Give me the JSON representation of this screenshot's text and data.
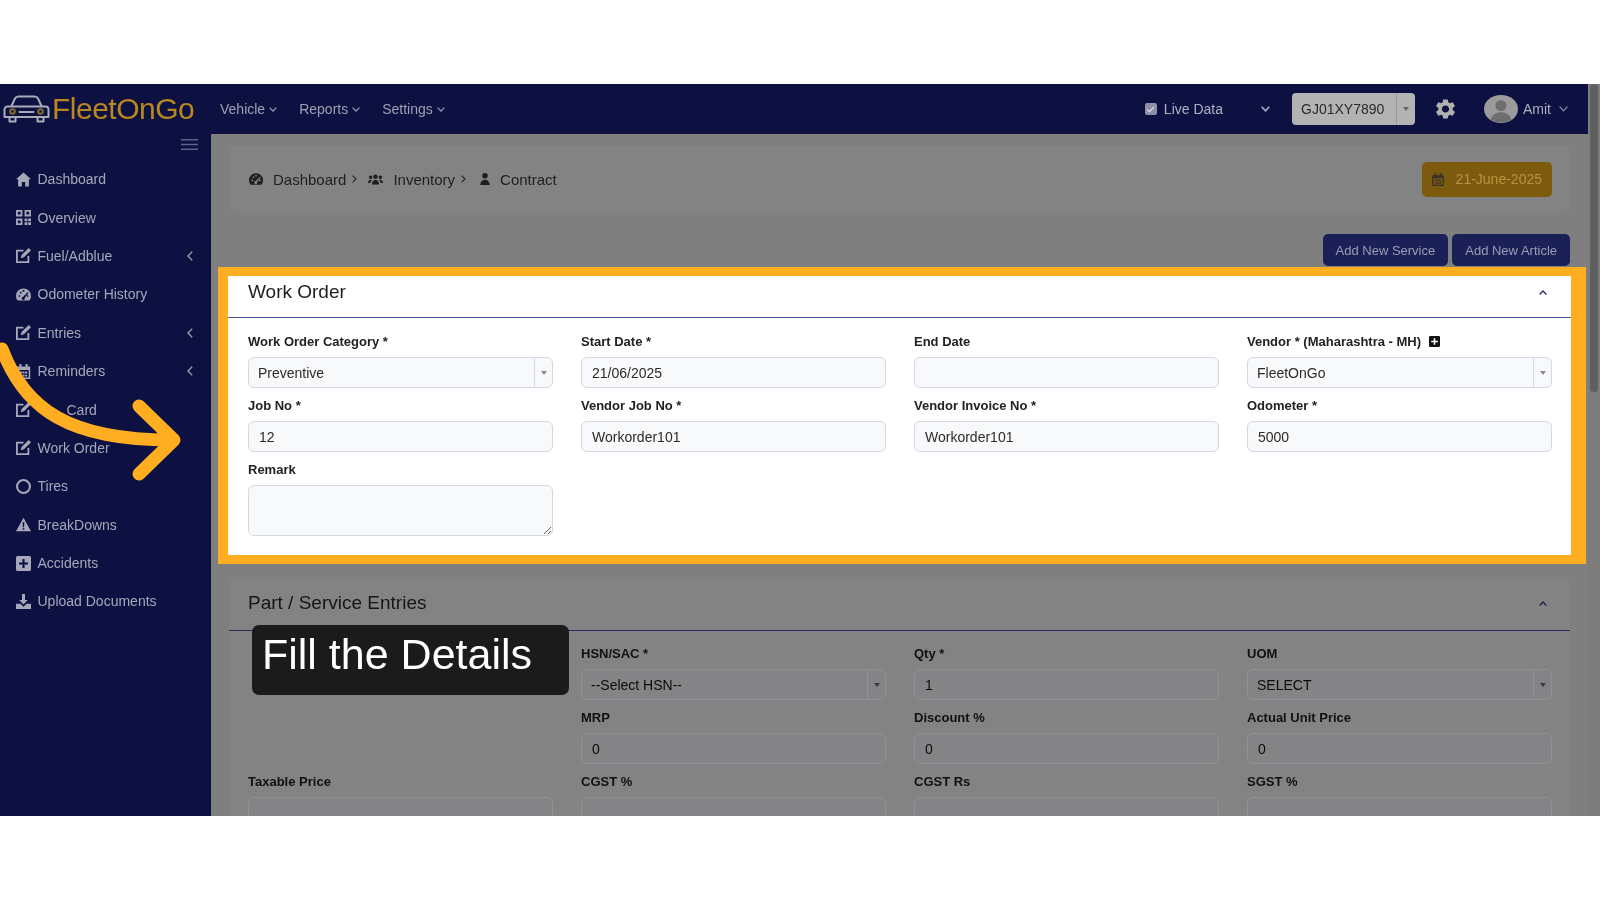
{
  "topbar": {
    "logo": "FleetOnGo",
    "menus": [
      {
        "label": "Vehicle"
      },
      {
        "label": "Reports"
      },
      {
        "label": "Settings"
      }
    ],
    "live_data": {
      "label": "Live Data",
      "checked": true
    },
    "vehicle_select": {
      "value": "GJ01XY7890"
    },
    "user": {
      "name": "Amit"
    }
  },
  "sidebar": {
    "items": [
      {
        "label": "Dashboard",
        "submenu": false
      },
      {
        "label": "Overview",
        "submenu": false
      },
      {
        "label": "Fuel/Adblue",
        "submenu": true
      },
      {
        "label": "Odometer History",
        "submenu": false
      },
      {
        "label": "Entries",
        "submenu": true
      },
      {
        "label": "Reminders",
        "submenu": true
      },
      {
        "label": "Card",
        "submenu": false
      },
      {
        "label": "Work Order",
        "submenu": false
      },
      {
        "label": "Tires",
        "submenu": false
      },
      {
        "label": "BreakDowns",
        "submenu": false
      },
      {
        "label": "Accidents",
        "submenu": false
      },
      {
        "label": "Upload Documents",
        "submenu": false
      }
    ]
  },
  "breadcrumb": [
    {
      "label": "Dashboard"
    },
    {
      "label": "Inventory"
    },
    {
      "label": "Contract"
    }
  ],
  "date_button": {
    "label": "21-June-2025"
  },
  "actions": [
    {
      "label": "Add New Service"
    },
    {
      "label": "Add New Article"
    }
  ],
  "sections": [
    {
      "title": "Work Order",
      "expanded": true,
      "highlighted": true,
      "rows": [
        [
          {
            "label": "Work Order Category *",
            "kind": "select",
            "value": "Preventive"
          },
          {
            "label": "Start Date *",
            "kind": "input",
            "value": "21/06/2025"
          },
          {
            "label": "End Date",
            "kind": "input"
          },
          {
            "label": "Vendor * (Maharashtra - MH)",
            "kind": "select",
            "value": "FleetOnGo",
            "add_button": true
          }
        ],
        [
          {
            "label": "Job No *",
            "kind": "input",
            "value": "12"
          },
          {
            "label": "Vendor Job No *",
            "kind": "input",
            "value": "Workorder101"
          },
          {
            "label": "Vendor Invoice No *",
            "kind": "input",
            "value": "Workorder101"
          },
          {
            "label": "Odometer *",
            "kind": "input",
            "value": "5000"
          }
        ],
        [
          {
            "label": "Remark",
            "kind": "textarea"
          }
        ]
      ]
    },
    {
      "title": "Part / Service Entries",
      "expanded": true,
      "highlighted": false,
      "rows": [
        [
          null,
          {
            "label": "HSN/SAC *",
            "kind": "select",
            "value": "--Select HSN--"
          },
          {
            "label": "Qty *",
            "kind": "input",
            "value": "1"
          },
          {
            "label": "UOM",
            "kind": "select",
            "value": "SELECT"
          }
        ],
        [
          null,
          {
            "label": "MRP",
            "kind": "input",
            "value": "0"
          },
          {
            "label": "Discount %",
            "kind": "input",
            "value": "0"
          },
          {
            "label": "Actual Unit Price",
            "kind": "input",
            "value": "0"
          }
        ],
        [
          {
            "label": "Taxable Price",
            "kind": "input"
          },
          {
            "label": "CGST %",
            "kind": "input"
          },
          {
            "label": "CGST Rs",
            "kind": "input"
          },
          {
            "label": "SGST %",
            "kind": "input"
          }
        ]
      ]
    }
  ],
  "annotation": {
    "caption": "Fill the Details"
  }
}
